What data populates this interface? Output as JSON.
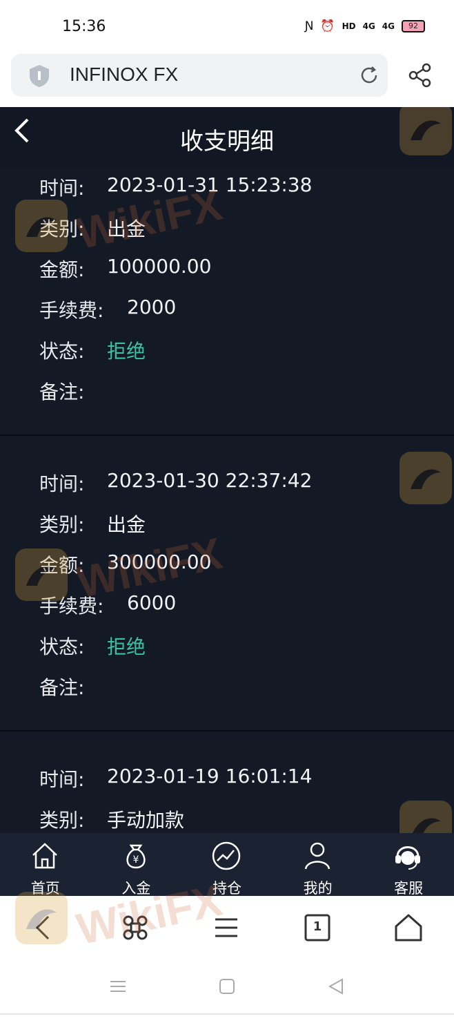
{
  "status_bar": {
    "time": "15:36",
    "battery": "92",
    "net1": "4G",
    "net2": "4G",
    "hd": "HD"
  },
  "browser": {
    "url_title": "INFINOX FX",
    "icons": [
      "shield-icon",
      "reload-icon",
      "share-icon"
    ]
  },
  "app": {
    "title": "收支明细",
    "records": [
      {
        "fields": [
          {
            "label": "时间:",
            "value": "2023-01-31 15:23:38"
          },
          {
            "label": "类别:",
            "value": "出金"
          },
          {
            "label": "金额:",
            "value": "100000.00"
          },
          {
            "label": "手续费:",
            "value": "2000"
          },
          {
            "label": "状态:",
            "value": "拒绝",
            "status": true
          },
          {
            "label": "备注:",
            "value": ""
          }
        ]
      },
      {
        "fields": [
          {
            "label": "时间:",
            "value": "2023-01-30 22:37:42"
          },
          {
            "label": "类别:",
            "value": "出金"
          },
          {
            "label": "金额:",
            "value": "300000.00"
          },
          {
            "label": "手续费:",
            "value": "6000"
          },
          {
            "label": "状态:",
            "value": "拒绝",
            "status": true
          },
          {
            "label": "备注:",
            "value": ""
          }
        ]
      },
      {
        "fields": [
          {
            "label": "时间:",
            "value": "2023-01-19 16:01:14"
          },
          {
            "label": "类别:",
            "value": "手动加款"
          }
        ]
      }
    ],
    "nav": [
      {
        "label": "首页",
        "icon": "home-icon"
      },
      {
        "label": "入金",
        "icon": "money-bag-icon"
      },
      {
        "label": "持仓",
        "icon": "chart-trend-icon"
      },
      {
        "label": "我的",
        "icon": "user-icon"
      },
      {
        "label": "客服",
        "icon": "headset-icon"
      }
    ]
  },
  "browser_toolbar": [
    "back-icon",
    "command-icon",
    "menu-icon",
    "tabs-icon",
    "home-icon"
  ],
  "tabs_count": "1",
  "watermark": "WikiFX",
  "colors": {
    "app_bg": "#131a25",
    "status_green": "#39c3a0",
    "nav_bg": "#1b2232"
  }
}
